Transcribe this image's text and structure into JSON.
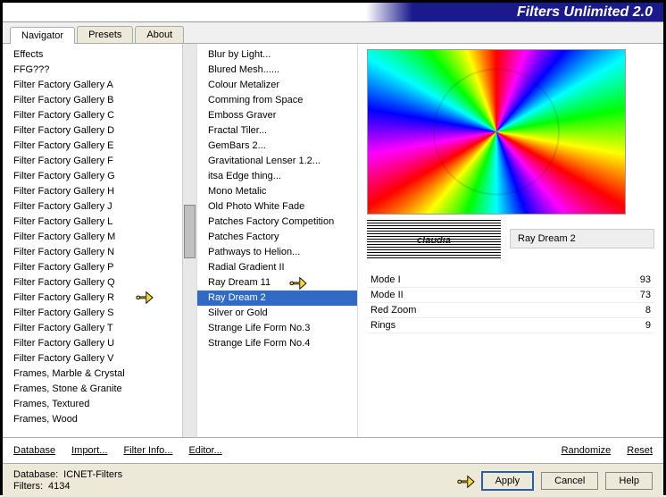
{
  "title": "Filters Unlimited 2.0",
  "tabs": [
    "Navigator",
    "Presets",
    "About"
  ],
  "activeTab": 0,
  "categories": [
    "Effects",
    "FFG???",
    "Filter Factory Gallery A",
    "Filter Factory Gallery B",
    "Filter Factory Gallery C",
    "Filter Factory Gallery D",
    "Filter Factory Gallery E",
    "Filter Factory Gallery F",
    "Filter Factory Gallery G",
    "Filter Factory Gallery H",
    "Filter Factory Gallery J",
    "Filter Factory Gallery L",
    "Filter Factory Gallery M",
    "Filter Factory Gallery N",
    "Filter Factory Gallery P",
    "Filter Factory Gallery Q",
    "Filter Factory Gallery R",
    "Filter Factory Gallery S",
    "Filter Factory Gallery T",
    "Filter Factory Gallery U",
    "Filter Factory Gallery V",
    "Frames, Marble & Crystal",
    "Frames, Stone & Granite",
    "Frames, Textured",
    "Frames, Wood"
  ],
  "filters": [
    "Blur by Light...",
    "Blured Mesh......",
    "Colour Metalizer",
    "Comming from Space",
    "Emboss Graver",
    "Fractal Tiler...",
    "GemBars 2...",
    "Gravitational Lenser 1.2...",
    "itsa Edge thing...",
    "Mono Metalic",
    "Old Photo White Fade",
    "Patches Factory Competition",
    "Patches Factory",
    "Pathways to Helion...",
    "Radial Gradient II",
    "Ray Dream 11",
    "Ray Dream 2",
    "Silver or Gold",
    "Strange Life Form No.3",
    "Strange Life Form No.4"
  ],
  "selectedFilterIndex": 16,
  "watermarkText": "claudia",
  "selectedFilterName": "Ray Dream 2",
  "params": [
    {
      "label": "Mode I",
      "value": "93"
    },
    {
      "label": "Mode II",
      "value": "73"
    },
    {
      "label": "Red Zoom",
      "value": "8"
    },
    {
      "label": "Rings",
      "value": "9"
    }
  ],
  "bottomButtons": {
    "database": "Database",
    "import": "Import...",
    "filterInfo": "Filter Info...",
    "editor": "Editor...",
    "randomize": "Randomize",
    "reset": "Reset"
  },
  "status": {
    "dbLabel": "Database:",
    "dbValue": "ICNET-Filters",
    "filtersLabel": "Filters:",
    "filtersValue": "4134"
  },
  "dialogButtons": {
    "apply": "Apply",
    "cancel": "Cancel",
    "help": "Help"
  }
}
